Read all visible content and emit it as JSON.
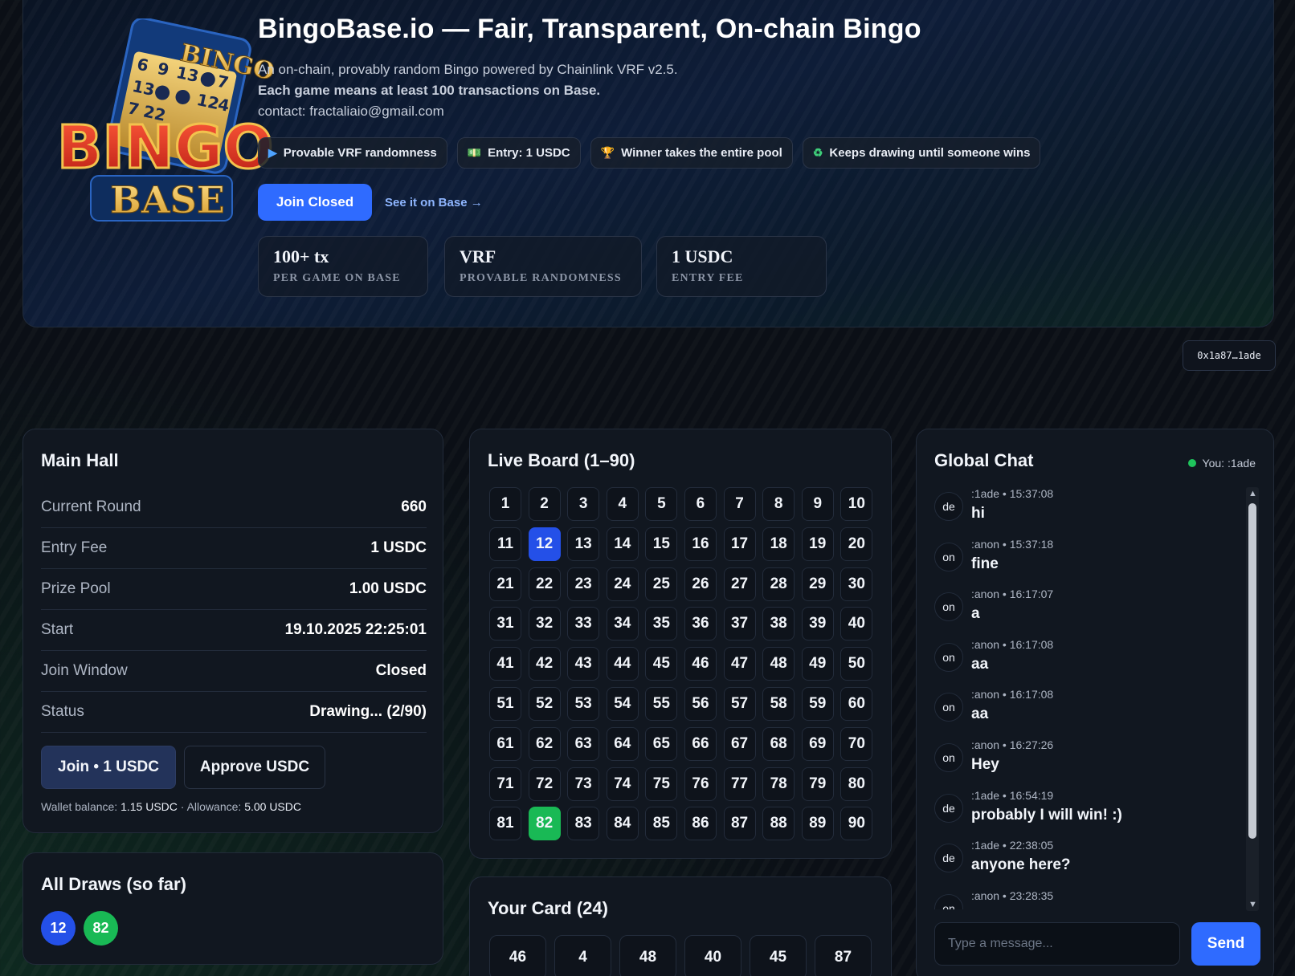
{
  "hero": {
    "logo_top": "BINGO",
    "logo_main": "BINGO",
    "logo_bottom": "BASE",
    "title": "BingoBase.io — Fair, Transparent, On-chain Bingo",
    "line1": "An on-chain, provably random Bingo powered by Chainlink VRF v2.5.",
    "line2": "Each game means at least 100 transactions on Base.",
    "line3": "contact: fractaliaio@gmail.com",
    "pills": [
      {
        "icon": "play-icon",
        "glyph": "▶",
        "label": "Provable VRF randomness"
      },
      {
        "icon": "money-icon",
        "glyph": "💵",
        "label": "Entry: 1 USDC"
      },
      {
        "icon": "trophy-icon",
        "glyph": "🏆",
        "label": "Winner takes the entire pool"
      },
      {
        "icon": "recycle-icon",
        "glyph": "♻",
        "label": "Keeps drawing until someone wins"
      }
    ],
    "join_button": "Join Closed",
    "see_base_link": "See it on Base →",
    "stats": [
      {
        "value": "100+ tx",
        "label": "PER GAME ON BASE"
      },
      {
        "value": "VRF",
        "label": "PROVABLE RANDOMNESS"
      },
      {
        "value": "1 USDC",
        "label": "ENTRY FEE"
      }
    ]
  },
  "wallet_address": "0x1a87…1ade",
  "main_hall": {
    "title": "Main Hall",
    "rows": [
      {
        "key": "Current Round",
        "value": "660"
      },
      {
        "key": "Entry Fee",
        "value": "1 USDC"
      },
      {
        "key": "Prize Pool",
        "value": "1.00 USDC"
      },
      {
        "key": "Start",
        "value": "19.10.2025 22:25:01"
      },
      {
        "key": "Join Window",
        "value": "Closed"
      },
      {
        "key": "Status",
        "value": "Drawing... (2/90)"
      }
    ],
    "join_button": "Join • 1 USDC",
    "approve_button": "Approve USDC",
    "wallet_balance_label": "Wallet balance:",
    "wallet_balance": "1.15 USDC",
    "separator": "·",
    "allowance_label": "Allowance:",
    "allowance": "5.00 USDC"
  },
  "draws": {
    "title": "All Draws (so far)",
    "balls": [
      {
        "number": "12",
        "color": "#2450e8"
      },
      {
        "number": "82",
        "color": "#19b955"
      }
    ]
  },
  "board": {
    "title": "Live Board (1–90)",
    "highlight_blue": [
      12
    ],
    "highlight_green": [
      82
    ],
    "blue_color": "#2450e8",
    "green_color": "#19b955"
  },
  "card": {
    "title": "Your Card (24)",
    "numbers": [
      "46",
      "4",
      "48",
      "40",
      "45",
      "87"
    ]
  },
  "chat": {
    "title": "Global Chat",
    "you_label": "You: :1ade",
    "messages": [
      {
        "avatar": "de",
        "meta": ":1ade • 15:37:08",
        "text": "hi"
      },
      {
        "avatar": "on",
        "meta": ":anon • 15:37:18",
        "text": "fine"
      },
      {
        "avatar": "on",
        "meta": ":anon • 16:17:07",
        "text": "a"
      },
      {
        "avatar": "on",
        "meta": ":anon • 16:17:08",
        "text": "aa"
      },
      {
        "avatar": "on",
        "meta": ":anon • 16:17:08",
        "text": "aa"
      },
      {
        "avatar": "on",
        "meta": ":anon • 16:27:26",
        "text": "Hey"
      },
      {
        "avatar": "de",
        "meta": ":1ade • 16:54:19",
        "text": "probably I will win! :)"
      },
      {
        "avatar": "de",
        "meta": ":1ade • 22:38:05",
        "text": "anyone here?"
      },
      {
        "avatar": "on",
        "meta": ":anon • 23:28:35",
        "text": ""
      }
    ],
    "input_placeholder": "Type a message...",
    "send_button": "Send"
  }
}
